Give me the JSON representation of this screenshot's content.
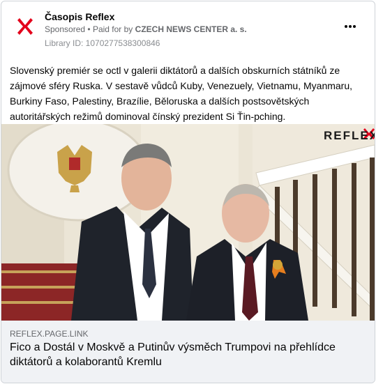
{
  "post": {
    "page_name": "Časopis Reflex",
    "sponsored_label": "Sponsored",
    "separator": "•",
    "paid_for_prefix": "Paid for by",
    "paid_for_name": "CZECH NEWS CENTER a. s.",
    "library_id": "Library ID: 1070277538300846",
    "more_icon": "more-dots-icon",
    "body_text": "Slovenský premiér se octl v galerii diktátorů a dalších obskurních státníků ze zájmové sféry Ruska. V sestavě vůdců Kuby, Venezuely, Vietnamu, Myanmaru, Burkiny Faso, Palestiny, Brazílie, Běloruska a dalších postsovětských autoritářských režimů dominoval čínský prezident Si Ťin-pching."
  },
  "image": {
    "watermark_text": "REFLEX",
    "brand_color": "#e3001b"
  },
  "link": {
    "domain": "REFLEX.PAGE.LINK",
    "headline": "Fico a Dostál v Moskvě a Putinův výsměch Trumpovi na přehlídce diktátorů a kolaborantů Kremlu"
  }
}
